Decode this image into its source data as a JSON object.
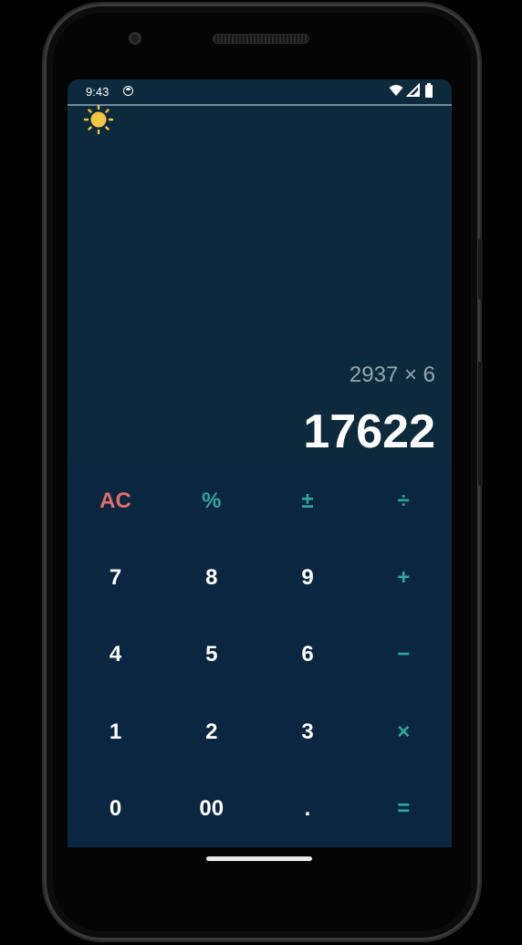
{
  "status": {
    "time": "9:43",
    "icons": [
      "app-icon",
      "wifi-icon",
      "signal-icon",
      "battery-icon"
    ]
  },
  "theme": {
    "icon": "sun-icon",
    "color": "#f6c544"
  },
  "display": {
    "expression": "2937 × 6",
    "result": "17622"
  },
  "keypad": {
    "rows": [
      [
        "AC",
        "%",
        "±",
        "÷"
      ],
      [
        "7",
        "8",
        "9",
        "+"
      ],
      [
        "4",
        "5",
        "6",
        "−"
      ],
      [
        "1",
        "2",
        "3",
        "×"
      ],
      [
        "0",
        "00",
        ".",
        "="
      ]
    ]
  },
  "colors": {
    "background": "#0c2a3b",
    "keypad": "#0b2640",
    "operator": "#2fa69e",
    "clear": "#e46e6a",
    "digit": "#ffffff"
  }
}
